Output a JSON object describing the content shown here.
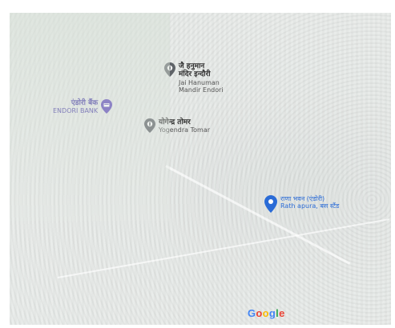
{
  "map": {
    "pois": {
      "hanuman_temple": {
        "name_hindi_line1": "जै हनुमान",
        "name_hindi_line2": "मंदिर इन्दौरी",
        "name_english_line1": "Jai Hanuman",
        "name_english_line2": "Mandir Endori",
        "icon": "place-of-worship-icon"
      },
      "endori_bank": {
        "name_hindi": "एंडोरी बैंक",
        "name_english": "ENDORI BANK",
        "icon": "bank-icon",
        "color": "#5b45b8"
      },
      "yogendra_tomar": {
        "name_hindi": "योगेन्द्र तोमर",
        "name_english": "Yogendra Tomar",
        "icon": "place-of-worship-icon"
      },
      "blue_place": {
        "name_hindi": "राणा भवन (एंडोरी)",
        "name_english": "Rath apura, बस स्टैंड",
        "icon": "location-pin-icon",
        "color": "#2a6bd6"
      }
    },
    "attribution": {
      "logo_text": "Google"
    }
  }
}
